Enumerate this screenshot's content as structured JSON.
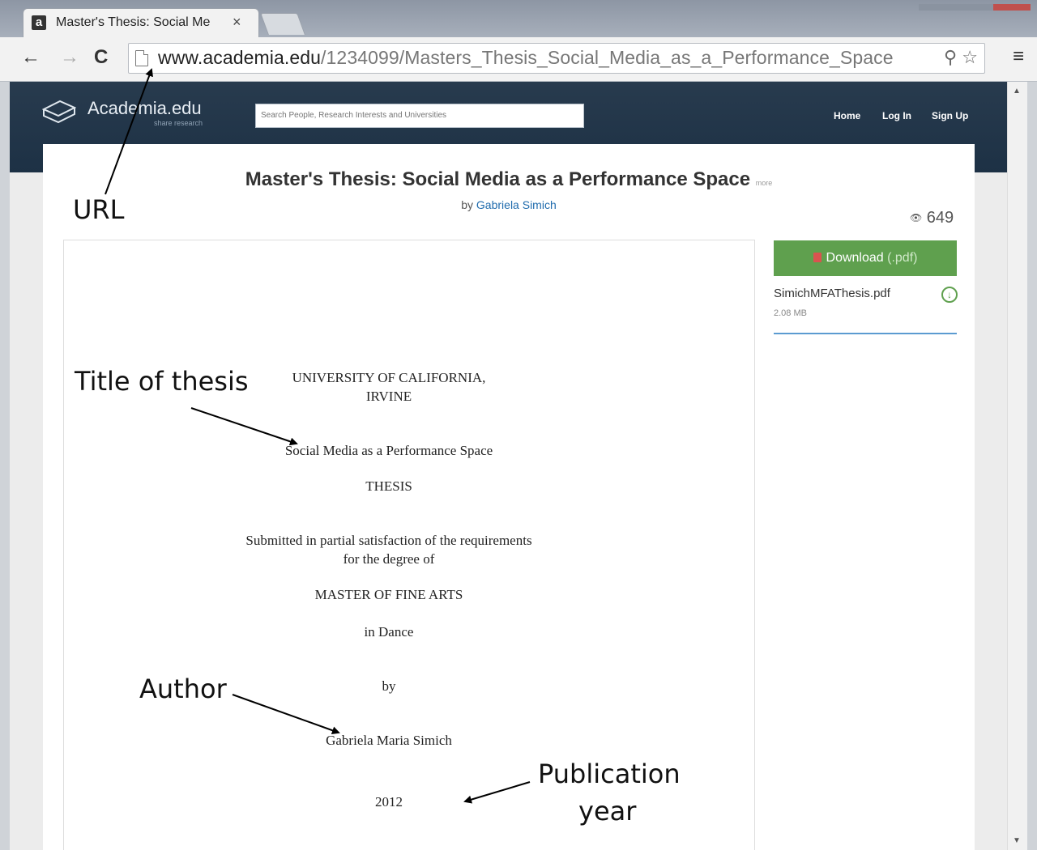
{
  "browser": {
    "tab_title": "Master's Thesis: Social Me",
    "tab_favicon": "a",
    "tab_close": "×",
    "url_host": "www.academia.edu",
    "url_path": "/1234099/Masters_Thesis_Social_Media_as_a_Performance_Space",
    "icons": [
      "back-arrow-icon",
      "forward-arrow-icon",
      "reload-icon",
      "page-icon",
      "search-icon",
      "star-icon",
      "menu-icon"
    ]
  },
  "site": {
    "logo_text": "Academia.edu",
    "logo_sub": "share research",
    "search_placeholder": "Search People, Research Interests and Universities",
    "nav": {
      "home": "Home",
      "login": "Log In",
      "signup": "Sign Up"
    }
  },
  "document": {
    "title": "Master's Thesis: Social Media as a Performance Space",
    "more": "more",
    "by": "by",
    "author": "Gabriela Simich",
    "views": "649",
    "download_label": "Download",
    "download_ext": "(.pdf)",
    "file_name": "SimichMFAThesis.pdf",
    "file_size": "2.08 MB"
  },
  "preview": {
    "university": "UNIVERSITY OF CALIFORNIA,",
    "campus": "IRVINE",
    "thesis_title": "Social Media as a Performance Space",
    "type": "THESIS",
    "submitted_1": "Submitted in partial satisfaction of the requirements",
    "submitted_2": "for the degree of",
    "degree": "MASTER OF FINE ARTS",
    "field": "in Dance",
    "by": "by",
    "author_full": "Gabriela Maria Simich",
    "year": "2012"
  },
  "annotations": {
    "url": "URL",
    "title_of_thesis": "Title of thesis",
    "author": "Author",
    "publication_1": "Publication",
    "publication_2": "year"
  },
  "colors": {
    "header_bg": "#24384c",
    "download_green": "#5fa04e",
    "link_blue": "#1f6bad"
  }
}
